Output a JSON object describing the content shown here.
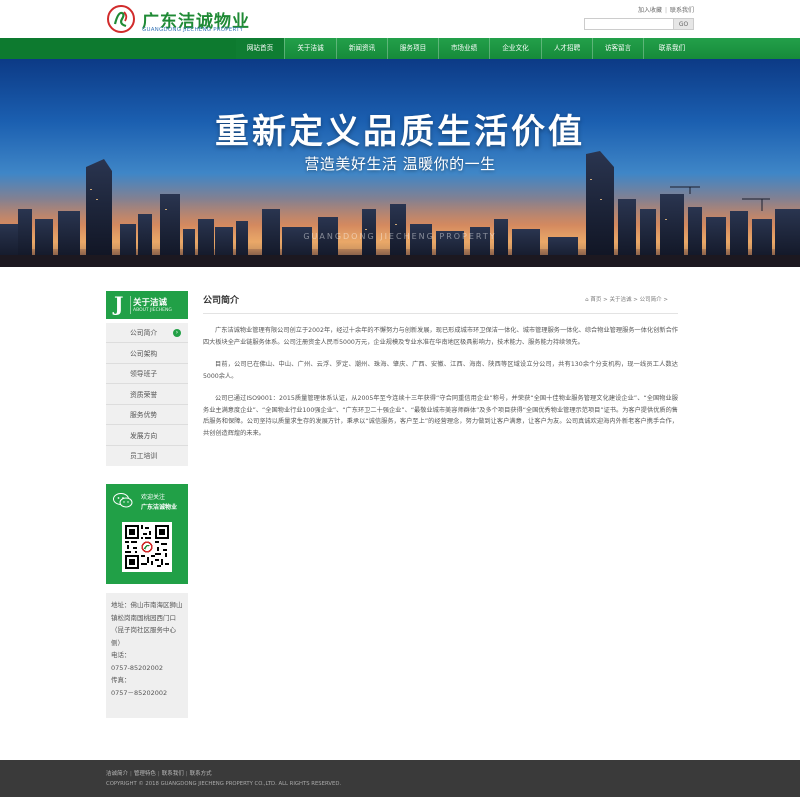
{
  "header": {
    "logo_cn": "广东洁诚物业",
    "logo_en": "GUANGDONG JIECHENG PROPERTY",
    "toplinks": [
      "加入收藏",
      "联系我们"
    ],
    "search_button": "GO"
  },
  "nav": {
    "items": [
      "网站首页",
      "关于洁诚",
      "新闻资讯",
      "服务项目",
      "市场业绩",
      "企业文化",
      "人才招聘",
      "访客留言",
      "联系我们"
    ]
  },
  "banner": {
    "title": "重新定义品质生活价值",
    "subtitle": "营造美好生活 温暖你的一生",
    "watermark": "GUANGDONG JIECHENG PROPERTY"
  },
  "sidebar": {
    "letter": "J",
    "title": "关于洁诚",
    "subtitle_en": "ABOUT JIECHENG",
    "menu": [
      "公司简介",
      "公司架构",
      "领导班子",
      "资质荣誉",
      "服务优势",
      "发展方向",
      "员工培训"
    ],
    "active_index": 0,
    "qr_text_1": "欢迎关注",
    "qr_text_2": "广东洁诚物业",
    "contact": {
      "address": "地址：佛山市南海区狮山镇松岗南国桃园西门口（昆子岗社区服务中心侧）",
      "phone_label": "电话：",
      "phone": "0757-85202002",
      "fax_label": "传真：",
      "fax": "0757－85202002"
    }
  },
  "main": {
    "title": "公司简介",
    "breadcrumb": [
      "首页",
      "关于洁诚",
      "公司简介"
    ],
    "paragraphs": [
      "广东洁诚物业管理有限公司创立于2002年，经过十余年的不懈努力与创新发展，现已形成城市环卫保洁一体化、城市管理服务一体化、综合物业管理服务一体化创新合作四大板块全产业链服务体系。公司注册资金人民币5000万元，企业规模及专业水准在华南地区极具影响力，技术能力、服务能力持续领先。",
      "目前，公司已在佛山、中山、广州、云浮、罗定、潮州、珠海、肇庆、广西、安徽、江西、海南、陕西等区域设立分公司，共有130余个分支机构，现一线员工人数达5000余人。",
      "公司已通过ISO9001：2015质量管理体系认证，从2005年至今连续十三年获得“守合同重信用企业”称号，并荣获“全国十佳物业服务管理文化建设企业”、“全国物业服务业主满意度企业”、“全国物业行业100强企业”、“广东环卫二十强企业”、“最敬业城市美容师群体”及多个项目获得“全国优秀物业管理示范项目”证书。为客户提供优质的售后服务和保障。公司坚持以质量求生存的发展方针，秉承以“诚信服务，客户至上”的经营理念，努力做到让客户满意，让客户为友。公司真诚欢迎海内外新老客户携手合作，共创创造辉煌的未来。"
    ]
  },
  "footer": {
    "links": [
      "洁诚简介",
      "管理特色",
      "联系我们",
      "联系方式"
    ],
    "copyright": "COPYRIGHT © 2018 GUANGDONG JIECHENG PROPERTY CO.,LTD. ALL RIGHTS RESERVED."
  },
  "colors": {
    "brand_green": "#21a047",
    "nav_dark": "#0d7a2f",
    "footer_bg": "#3a3a3a"
  }
}
